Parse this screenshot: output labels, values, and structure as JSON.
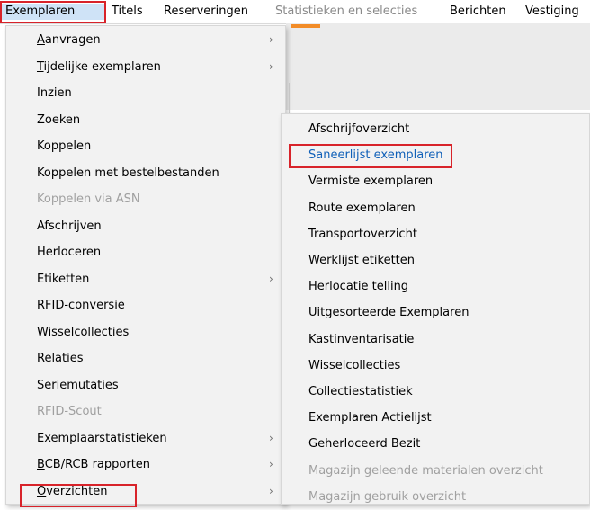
{
  "menubar": {
    "items": [
      {
        "label": "Exemplaren"
      },
      {
        "label": "Titels"
      },
      {
        "label": "Reserveringen"
      },
      {
        "label": "Statistieken en selecties"
      },
      {
        "label": "Berichten"
      },
      {
        "label": "Vestiging"
      }
    ]
  },
  "exemplaren_menu": {
    "items": [
      {
        "label": "Aanvragen",
        "mnemonic": "A",
        "rest": "anvragen",
        "submenu": true
      },
      {
        "label": "Tijdelijke exemplaren",
        "mnemonic": "T",
        "rest": "ijdelijke exemplaren",
        "submenu": true
      },
      {
        "label": "Inzien"
      },
      {
        "label": "Zoeken"
      },
      {
        "label": "Koppelen"
      },
      {
        "label": "Koppelen met bestelbestanden"
      },
      {
        "label": "Koppelen via ASN",
        "disabled": true
      },
      {
        "label": "Afschrijven"
      },
      {
        "label": "Herloceren"
      },
      {
        "label": "Etiketten",
        "submenu": true
      },
      {
        "label": "RFID-conversie"
      },
      {
        "label": "Wisselcollecties"
      },
      {
        "label": "Relaties"
      },
      {
        "label": "Seriemutaties"
      },
      {
        "label": "RFID-Scout",
        "disabled": true
      },
      {
        "label": "Exemplaarstatistieken",
        "submenu": true
      },
      {
        "label": "BCB/RCB rapporten",
        "mnemonic": "B",
        "rest": "CB/RCB rapporten",
        "submenu": true
      },
      {
        "label": "Overzichten",
        "mnemonic": "O",
        "rest": "verzichten",
        "submenu": true
      }
    ]
  },
  "overzichten_menu": {
    "items": [
      {
        "label": "Afschrijfoverzicht"
      },
      {
        "label": "Saneerlijst exemplaren"
      },
      {
        "label": "Vermiste exemplaren"
      },
      {
        "label": "Route exemplaren"
      },
      {
        "label": "Transportoverzicht"
      },
      {
        "label": "Werklijst etiketten"
      },
      {
        "label": "Herlocatie telling"
      },
      {
        "label": "Uitgesorteerde Exemplaren"
      },
      {
        "label": "Kastinventarisatie"
      },
      {
        "label": "Wisselcollecties"
      },
      {
        "label": "Collectiestatistiek"
      },
      {
        "label": "Exemplaren Actielijst"
      },
      {
        "label": "Geherloceerd Bezit"
      },
      {
        "label": "Magazijn geleende materialen overzicht",
        "disabled": true
      },
      {
        "label": "Magazijn gebruik overzicht",
        "disabled": true
      }
    ]
  },
  "colors": {
    "highlight_box": "#d8232a",
    "accent_strip": "#f28c28",
    "link_blue": "#1060b8"
  },
  "icons": {
    "submenu_arrow": "chevron-right-icon"
  }
}
